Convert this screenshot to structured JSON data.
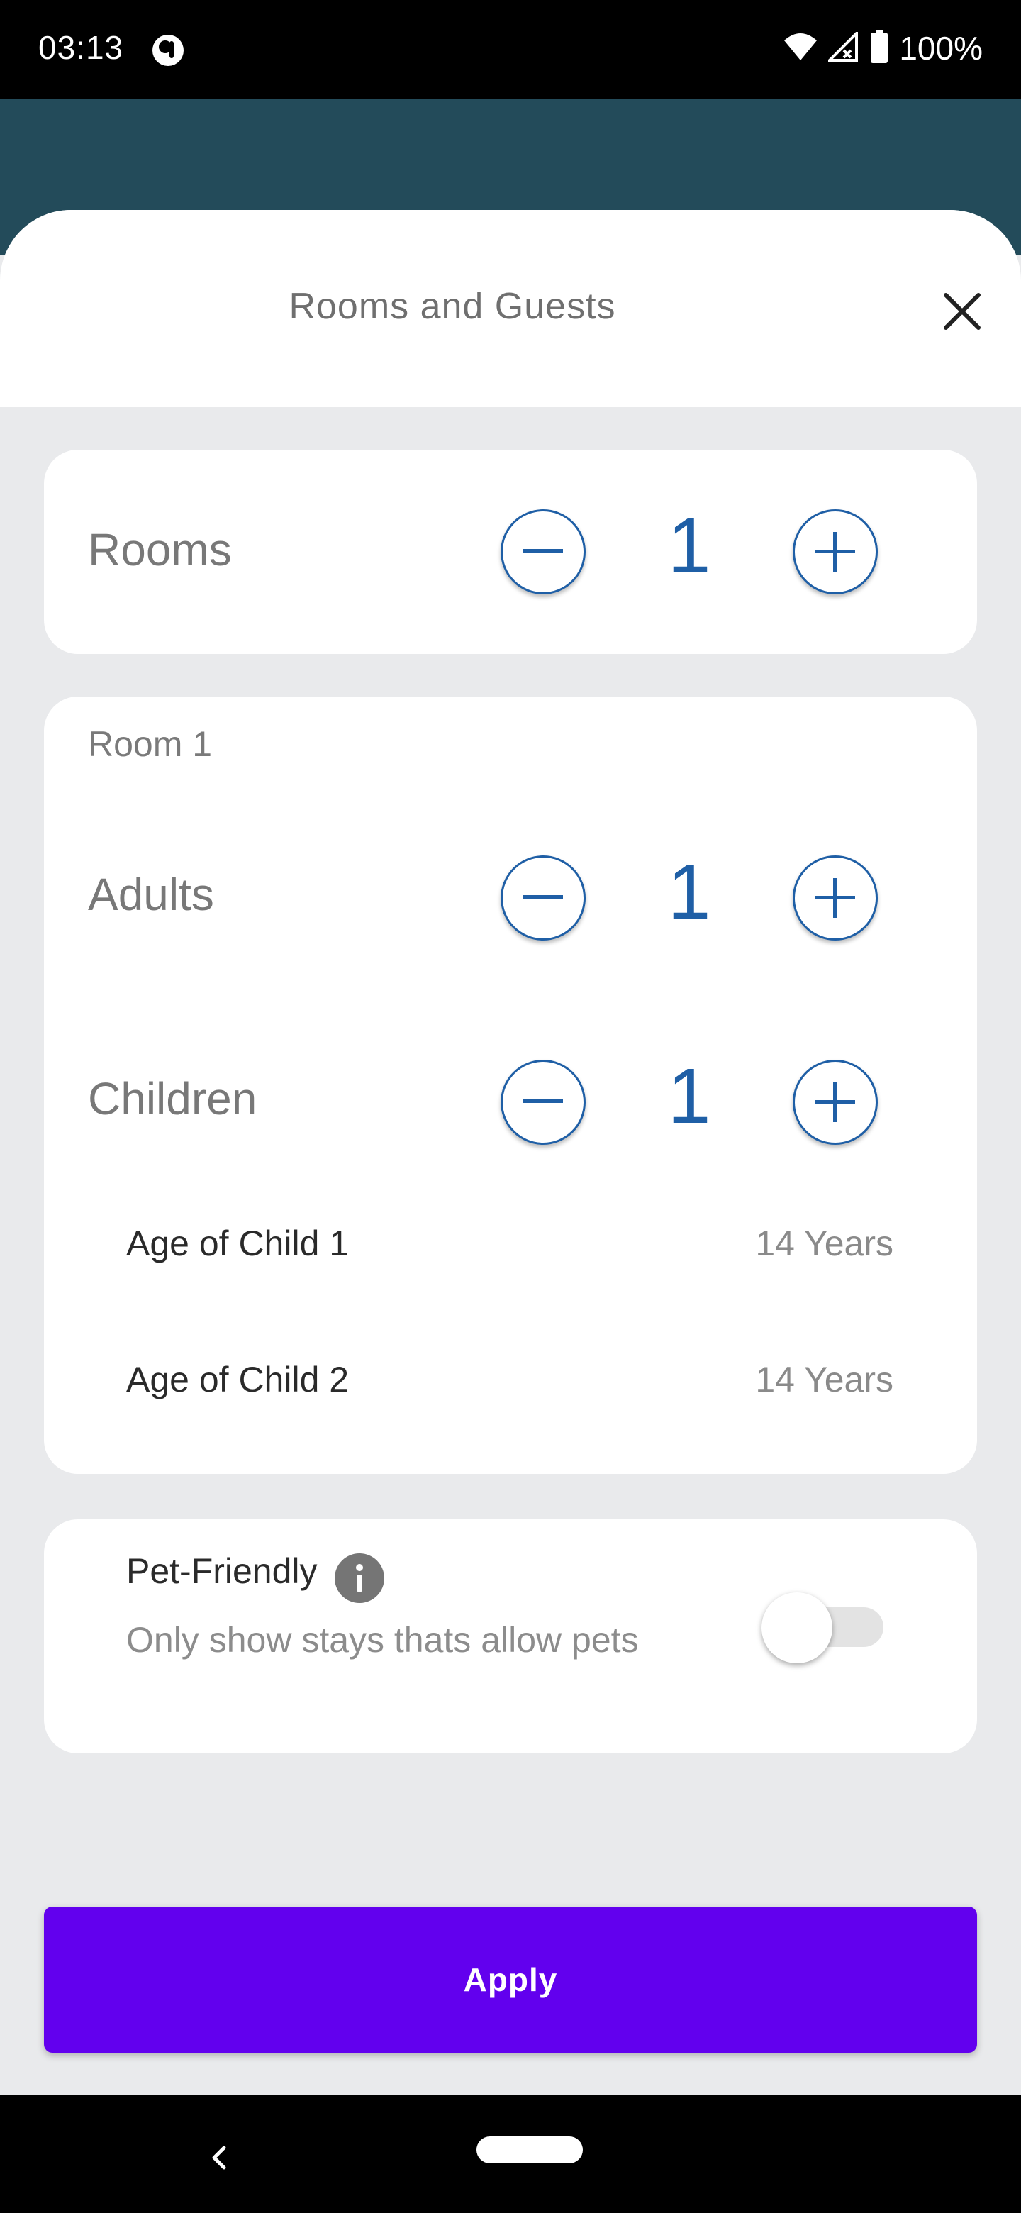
{
  "status_bar": {
    "time": "03:13",
    "battery": "100%",
    "icons": [
      "notification-icon",
      "wifi-icon",
      "signal-icon",
      "battery-icon"
    ]
  },
  "sheet": {
    "title": "Rooms and Guests",
    "close_icon": "close-icon"
  },
  "rooms": {
    "label": "Rooms",
    "value": "1"
  },
  "room1": {
    "title": "Room 1",
    "adults": {
      "label": "Adults",
      "value": "1"
    },
    "children": {
      "label": "Children",
      "value": "1"
    },
    "child_ages": [
      {
        "label": "Age of Child 1",
        "value": "14 Years"
      },
      {
        "label": "Age of Child 2",
        "value": "14 Years"
      }
    ]
  },
  "pet": {
    "title": "Pet-Friendly",
    "description": "Only show stays thats allow pets",
    "toggle_on": false
  },
  "apply_label": "Apply",
  "colors": {
    "accent_blue": "#1f5fa6",
    "apply_purple": "#6200ee",
    "header_teal": "#234b5a",
    "sheet_bg": "#e9eaec"
  }
}
